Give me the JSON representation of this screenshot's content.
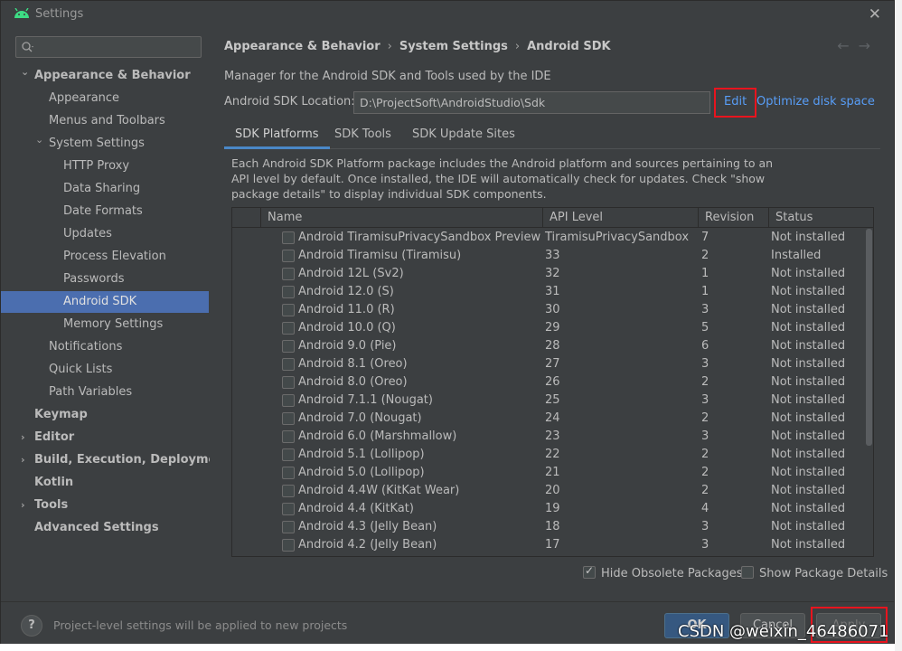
{
  "window": {
    "title": "Settings",
    "close_glyph": "✕"
  },
  "sidebar": {
    "search_placeholder": "",
    "items": [
      {
        "label": "Appearance & Behavior",
        "level": 0,
        "bold": true,
        "expanded": true
      },
      {
        "label": "Appearance",
        "level": 1
      },
      {
        "label": "Menus and Toolbars",
        "level": 1
      },
      {
        "label": "System Settings",
        "level": 1,
        "expanded": true
      },
      {
        "label": "HTTP Proxy",
        "level": 2
      },
      {
        "label": "Data Sharing",
        "level": 2
      },
      {
        "label": "Date Formats",
        "level": 2
      },
      {
        "label": "Updates",
        "level": 2
      },
      {
        "label": "Process Elevation",
        "level": 2
      },
      {
        "label": "Passwords",
        "level": 2
      },
      {
        "label": "Android SDK",
        "level": 2,
        "selected": true
      },
      {
        "label": "Memory Settings",
        "level": 2
      },
      {
        "label": "Notifications",
        "level": 1
      },
      {
        "label": "Quick Lists",
        "level": 1
      },
      {
        "label": "Path Variables",
        "level": 1
      },
      {
        "label": "Keymap",
        "level": 0,
        "bold": true
      },
      {
        "label": "Editor",
        "level": 0,
        "bold": true,
        "collapsed": true
      },
      {
        "label": "Build, Execution, Deployment",
        "level": 0,
        "bold": true,
        "collapsed": true
      },
      {
        "label": "Kotlin",
        "level": 0,
        "bold": true
      },
      {
        "label": "Tools",
        "level": 0,
        "bold": true,
        "collapsed": true
      },
      {
        "label": "Advanced Settings",
        "level": 0,
        "bold": true
      }
    ]
  },
  "main": {
    "breadcrumb": [
      "Appearance & Behavior",
      "System Settings",
      "Android SDK"
    ],
    "description": "Manager for the Android SDK and Tools used by the IDE",
    "sdk_location_label": "Android SDK Location:",
    "sdk_location_value": "D:\\ProjectSoft\\AndroidStudio\\Sdk",
    "edit_label": "Edit",
    "optimize_label": "Optimize disk space",
    "tabs": [
      "SDK Platforms",
      "SDK Tools",
      "SDK Update Sites"
    ],
    "active_tab": 0,
    "panel_description": "Each Android SDK Platform package includes the Android platform and sources pertaining to an API level by default. Once installed, the IDE will automatically check for updates. Check \"show package details\" to display individual SDK components.",
    "table": {
      "columns": [
        "Name",
        "API Level",
        "Revision",
        "Status"
      ],
      "rows": [
        [
          "Android TiramisuPrivacySandbox Preview",
          "TiramisuPrivacySandbox",
          "7",
          "Not installed"
        ],
        [
          "Android Tiramisu (Tiramisu)",
          "33",
          "2",
          "Installed"
        ],
        [
          "Android 12L (Sv2)",
          "32",
          "1",
          "Not installed"
        ],
        [
          "Android 12.0 (S)",
          "31",
          "1",
          "Not installed"
        ],
        [
          "Android 11.0 (R)",
          "30",
          "3",
          "Not installed"
        ],
        [
          "Android 10.0 (Q)",
          "29",
          "5",
          "Not installed"
        ],
        [
          "Android 9.0 (Pie)",
          "28",
          "6",
          "Not installed"
        ],
        [
          "Android 8.1 (Oreo)",
          "27",
          "3",
          "Not installed"
        ],
        [
          "Android 8.0 (Oreo)",
          "26",
          "2",
          "Not installed"
        ],
        [
          "Android 7.1.1 (Nougat)",
          "25",
          "3",
          "Not installed"
        ],
        [
          "Android 7.0 (Nougat)",
          "24",
          "2",
          "Not installed"
        ],
        [
          "Android 6.0 (Marshmallow)",
          "23",
          "3",
          "Not installed"
        ],
        [
          "Android 5.1 (Lollipop)",
          "22",
          "2",
          "Not installed"
        ],
        [
          "Android 5.0 (Lollipop)",
          "21",
          "2",
          "Not installed"
        ],
        [
          "Android 4.4W (KitKat Wear)",
          "20",
          "2",
          "Not installed"
        ],
        [
          "Android 4.4 (KitKat)",
          "19",
          "4",
          "Not installed"
        ],
        [
          "Android 4.3 (Jelly Bean)",
          "18",
          "3",
          "Not installed"
        ],
        [
          "Android 4.2 (Jelly Bean)",
          "17",
          "3",
          "Not installed"
        ]
      ]
    },
    "hide_obsolete_label": "Hide Obsolete Packages",
    "hide_obsolete_checked": true,
    "show_details_label": "Show Package Details",
    "show_details_checked": false
  },
  "footer": {
    "help_glyph": "?",
    "message": "Project-level settings will be applied to new projects",
    "ok_label": "OK",
    "cancel_label": "Cancel",
    "apply_label": "Apply"
  },
  "watermark": "CSDN @weixin_46486071",
  "colors": {
    "accent": "#4b6eaf",
    "link": "#589df6",
    "highlight_box": "#e8141e",
    "background": "#3c3f41"
  }
}
